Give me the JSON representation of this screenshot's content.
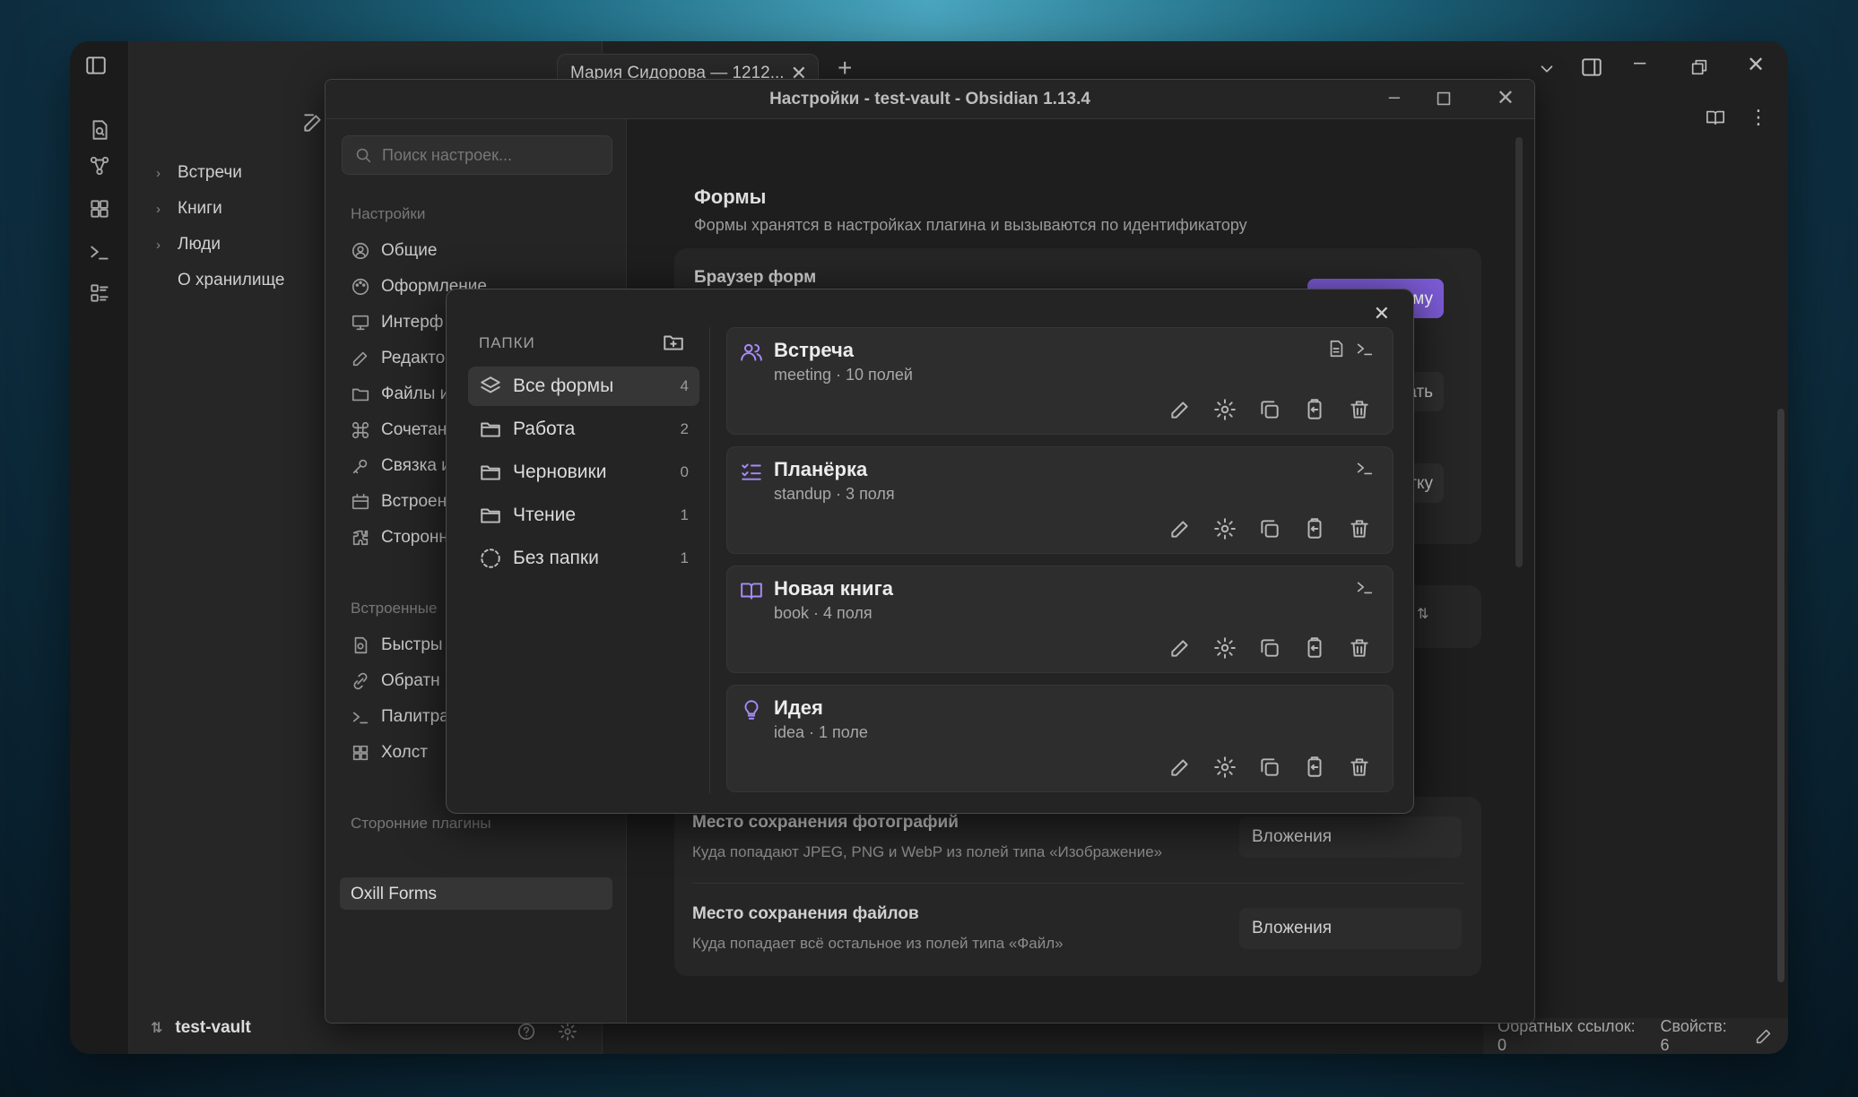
{
  "workspace": {
    "tab_title": "Мария Сидорова — 1212...",
    "vault_name": "test-vault",
    "tree": [
      {
        "label": "Встречи",
        "folder": true
      },
      {
        "label": "Книги",
        "folder": true
      },
      {
        "label": "Люди",
        "folder": true
      },
      {
        "label": "О хранилище",
        "folder": false
      }
    ],
    "status": {
      "backlinks": "Обратных ссылок: 0",
      "properties": "Свойств: 6"
    }
  },
  "settings": {
    "title": "Настройки - test-vault - Obsidian 1.13.4",
    "search_placeholder": "Поиск настроек...",
    "nav_head_settings": "Настройки",
    "nav_items": [
      "Общие",
      "Оформление",
      "Интерфейс",
      "Редактор",
      "Файлы и ссылки",
      "Сочетания клавиш",
      "Связка ключей",
      "Встроенные",
      "Сторонние"
    ],
    "nav_items_visible": [
      "Общие",
      "Оформление",
      "Интерф",
      "Редакто",
      "Файлы и",
      "Сочетан",
      "Связка и",
      "Встроен",
      "Сторонн"
    ],
    "nav_head_core": "Встроенные",
    "core_items": [
      "Быстры",
      "Обратн",
      "Палитра",
      "Холст"
    ],
    "nav_head_community": "Сторонние плагины",
    "community_item": "Oxill Forms",
    "section_title": "Формы",
    "section_desc": "Формы хранятся в настройках плагина и вызываются по идентификатору",
    "browser_label": "Браузер форм",
    "button_partial_1": "му",
    "button_partial_2": "ать",
    "button_partial_3": "тку",
    "photo_setting": {
      "name": "Место сохранения фотографий",
      "desc": "Куда попадают JPEG, PNG и WebP из полей типа «Изображение»",
      "value": "Вложения"
    },
    "file_setting": {
      "name": "Место сохранения файлов",
      "desc": "Куда попадает всё остальное из полей типа «Файл»",
      "value": "Вложения"
    }
  },
  "forms_modal": {
    "folders_heading": "ПАПКИ",
    "folders": [
      {
        "label": "Все формы",
        "count": "4",
        "active": true
      },
      {
        "label": "Работа",
        "count": "2"
      },
      {
        "label": "Черновики",
        "count": "0"
      },
      {
        "label": "Чтение",
        "count": "1"
      },
      {
        "label": "Без папки",
        "count": "1"
      }
    ],
    "forms": [
      {
        "title": "Встреча",
        "subtitle": "meeting · 10 полей",
        "icon": "users-icon"
      },
      {
        "title": "Планёрка",
        "subtitle": "standup · 3 поля",
        "icon": "list-checks-icon"
      },
      {
        "title": "Новая книга",
        "subtitle": "book · 4 поля",
        "icon": "book-open-icon"
      },
      {
        "title": "Идея",
        "subtitle": "idea · 1 поле",
        "icon": "lightbulb-icon"
      }
    ],
    "accent_color": "#a78bfa"
  }
}
